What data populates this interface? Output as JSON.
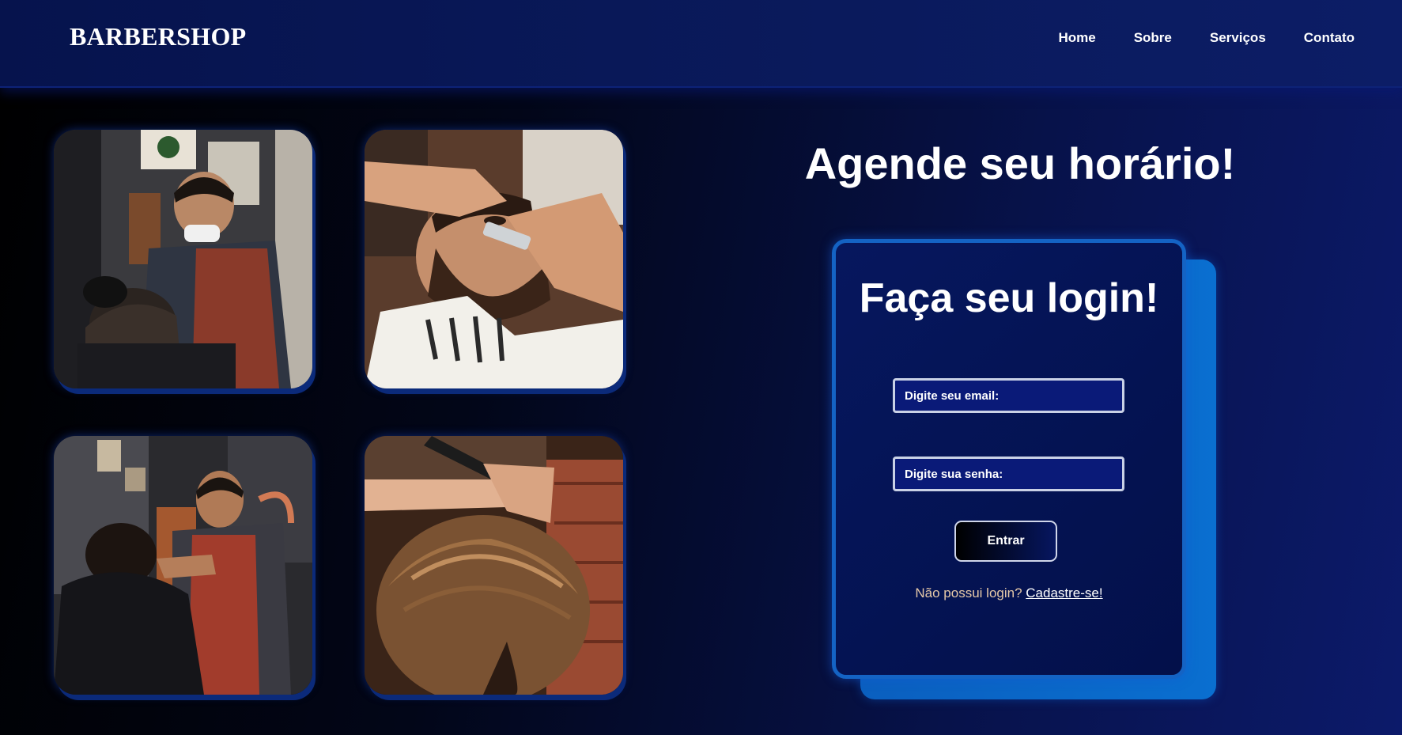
{
  "header": {
    "logo": "BARBERSHOP",
    "nav": [
      {
        "label": "Home"
      },
      {
        "label": "Sobre"
      },
      {
        "label": "Serviços"
      },
      {
        "label": "Contato"
      }
    ]
  },
  "hero": {
    "title": "Agende seu horário!"
  },
  "login": {
    "title": "Faça seu login!",
    "email_placeholder": "Digite seu email:",
    "password_placeholder": "Digite sua senha:",
    "submit_label": "Entrar",
    "signup_prompt": "Não possui login?",
    "signup_link": "Cadastre-se!"
  },
  "gallery": {
    "images": [
      {
        "icon": "barber-cutting-hair-photo"
      },
      {
        "icon": "beard-shaving-photo"
      },
      {
        "icon": "barber-trimming-client-photo"
      },
      {
        "icon": "hair-comb-cut-photo"
      }
    ]
  },
  "colors": {
    "navbar": "#0a1a5c",
    "card_border": "#1463c4",
    "card_back": "#0a6fd0",
    "field_bg": "#0a1a78"
  }
}
